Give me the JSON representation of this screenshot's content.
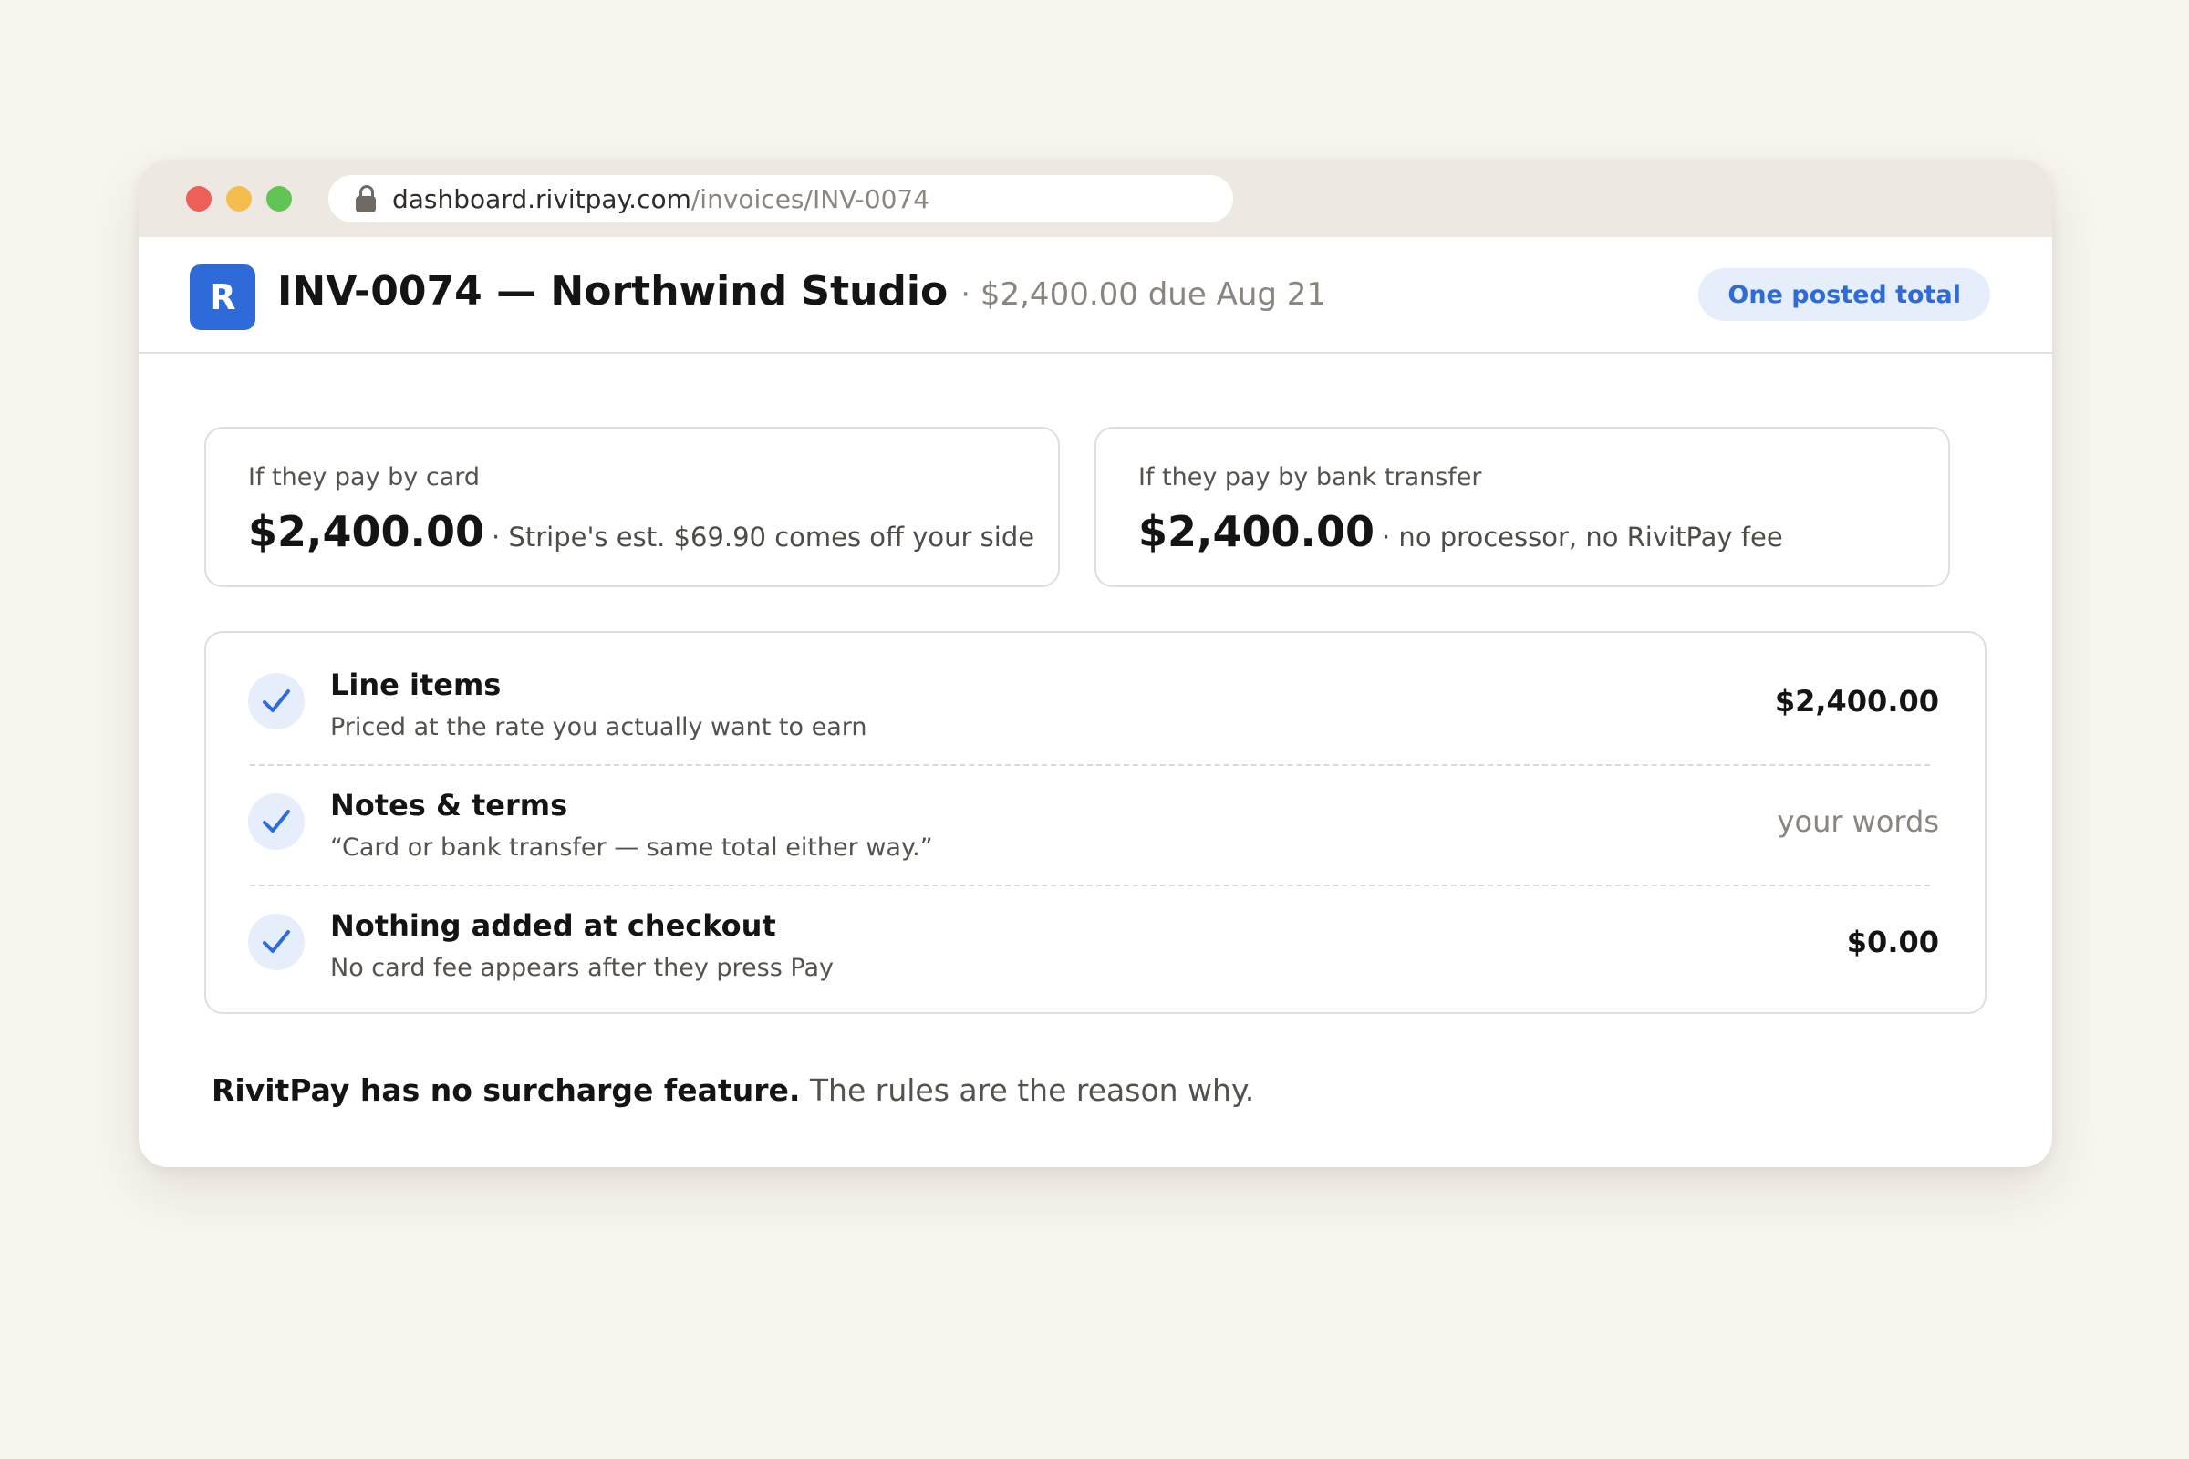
{
  "browser": {
    "url_domain": "dashboard.rivitpay.com",
    "url_path": "/invoices/INV-0074",
    "lock_icon": "lock-icon"
  },
  "header": {
    "logo_letter": "R",
    "invoice_title": "INV-0074 — Northwind Studio",
    "invoice_subtitle": "· $2,400.00 due Aug 21",
    "badge": "One posted total"
  },
  "cards": [
    {
      "label": "If they pay by card",
      "amount": "$2,400.00",
      "note": "· Stripe's est. $69.90 comes off your side"
    },
    {
      "label": "If they pay by bank transfer",
      "amount": "$2,400.00",
      "note": "· no processor, no RivitPay fee"
    }
  ],
  "checklist": [
    {
      "title": "Line items",
      "description": "Priced at the rate you actually want to earn",
      "value": "$2,400.00",
      "icon": "checkmark-icon"
    },
    {
      "title": "Notes & terms",
      "description": "“Card or bank transfer — same total either way.”",
      "value": "your words",
      "icon": "checkmark-icon"
    },
    {
      "title": "Nothing added at checkout",
      "description": "No card fee appears after they press Pay",
      "value": "$0.00",
      "icon": "checkmark-icon"
    }
  ],
  "footer": {
    "bold": "RivitPay has no surcharge feature.",
    "rest": " The rules are the reason why."
  },
  "colors": {
    "accent": "#2f6bd8",
    "accent_light": "#e6eefb",
    "background": "#f8f5ef",
    "window_close": "#ee5f57",
    "window_minimize": "#f5bd4f",
    "window_maximize": "#61c454"
  }
}
